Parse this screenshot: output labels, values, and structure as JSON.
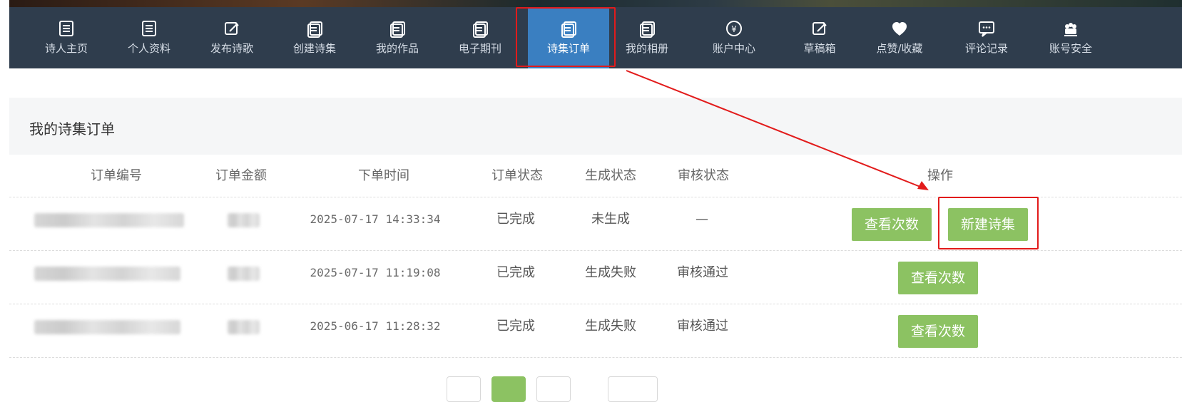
{
  "nav": {
    "items": [
      {
        "label": "诗人主页",
        "icon": "list-icon"
      },
      {
        "label": "个人资料",
        "icon": "list-icon"
      },
      {
        "label": "发布诗歌",
        "icon": "edit-icon"
      },
      {
        "label": "创建诗集",
        "icon": "document-icon"
      },
      {
        "label": "我的作品",
        "icon": "document-icon"
      },
      {
        "label": "电子期刊",
        "icon": "document-icon"
      },
      {
        "label": "诗集订单",
        "icon": "document-icon",
        "active": true
      },
      {
        "label": "我的相册",
        "icon": "document-icon"
      },
      {
        "label": "账户中心",
        "icon": "yen-icon"
      },
      {
        "label": "草稿箱",
        "icon": "edit-icon"
      },
      {
        "label": "点赞/收藏",
        "icon": "heart-icon"
      },
      {
        "label": "评论记录",
        "icon": "comment-icon"
      },
      {
        "label": "账号安全",
        "icon": "security-icon"
      }
    ]
  },
  "panel": {
    "title": "我的诗集订单"
  },
  "table": {
    "headers": {
      "order_no": "订单编号",
      "amount": "订单金额",
      "time": "下单时间",
      "order_status": "订单状态",
      "gen_status": "生成状态",
      "review_status": "审核状态",
      "actions": "操作"
    },
    "rows": [
      {
        "time": "2025-07-17 14:33:34",
        "order_status": "已完成",
        "gen_status": "未生成",
        "review_status": "—",
        "actions": [
          "查看次数",
          "新建诗集"
        ]
      },
      {
        "time": "2025-07-17 11:19:08",
        "order_status": "已完成",
        "gen_status": "生成失败",
        "review_status": "审核通过",
        "actions": [
          "查看次数"
        ]
      },
      {
        "time": "2025-06-17 11:28:32",
        "order_status": "已完成",
        "gen_status": "生成失败",
        "review_status": "审核通过",
        "actions": [
          "查看次数"
        ]
      }
    ]
  },
  "colors": {
    "nav_bg": "#2f3d4d",
    "nav_active": "#3a7fc1",
    "button_green": "#8cc262",
    "annotation_red": "#e21b1b"
  }
}
